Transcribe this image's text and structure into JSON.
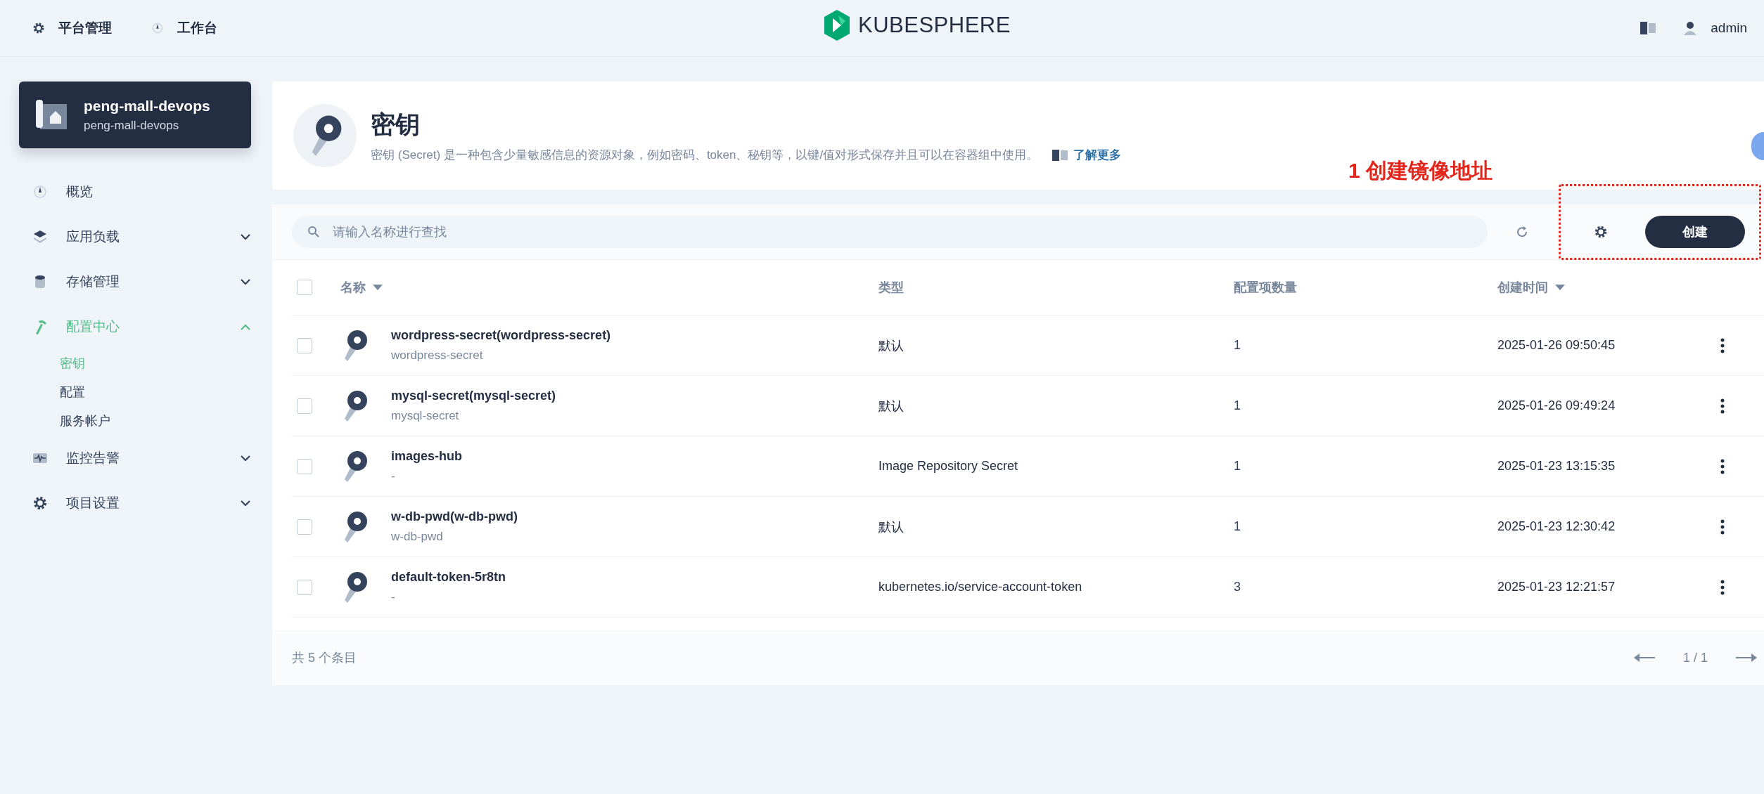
{
  "top_bar": {
    "nav": [
      {
        "label": "平台管理"
      },
      {
        "label": "工作台"
      }
    ],
    "logo_text": "KUBESPHERE",
    "user": "admin"
  },
  "project": {
    "title": "peng-mall-devops",
    "subtitle": "peng-mall-devops"
  },
  "sidebar": {
    "items": [
      {
        "label": "概览",
        "kind": "link",
        "selected": false
      },
      {
        "label": "应用负载",
        "kind": "group",
        "expanded": false,
        "selected": false
      },
      {
        "label": "存储管理",
        "kind": "group",
        "expanded": false,
        "selected": false
      },
      {
        "label": "配置中心",
        "kind": "group",
        "expanded": true,
        "selected": true,
        "children": [
          {
            "label": "密钥",
            "selected": true
          },
          {
            "label": "配置",
            "selected": false
          },
          {
            "label": "服务帐户",
            "selected": false
          }
        ]
      },
      {
        "label": "监控告警",
        "kind": "group",
        "expanded": false,
        "selected": false
      },
      {
        "label": "项目设置",
        "kind": "group",
        "expanded": false,
        "selected": false
      }
    ]
  },
  "header": {
    "title": "密钥",
    "description": "密钥 (Secret) 是一种包含少量敏感信息的资源对象，例如密码、token、秘钥等，以键/值对形式保存并且可以在容器组中使用。",
    "link": "了解更多"
  },
  "annotation": {
    "text": "1 创建镜像地址"
  },
  "toolbar": {
    "search": {
      "placeholder": "请输入名称进行查找"
    },
    "create_button": "创建"
  },
  "table": {
    "select_all_checked": false,
    "columns": [
      {
        "label": "名称",
        "sortable": true
      },
      {
        "label": "类型",
        "sortable": false
      },
      {
        "label": "配置项数量",
        "sortable": false
      },
      {
        "label": "创建时间",
        "sortable": true
      }
    ],
    "rows": [
      {
        "checked": false,
        "name": "wordpress-secret(wordpress-secret)",
        "alias": "wordpress-secret",
        "type": "默认",
        "count": "1",
        "created": "2025-01-26 09:50:45"
      },
      {
        "checked": false,
        "name": "mysql-secret(mysql-secret)",
        "alias": "mysql-secret",
        "type": "默认",
        "count": "1",
        "created": "2025-01-26 09:49:24"
      },
      {
        "checked": false,
        "name": "images-hub",
        "alias": "-",
        "type": "Image Repository Secret",
        "count": "1",
        "created": "2025-01-23 13:15:35"
      },
      {
        "checked": false,
        "name": "w-db-pwd(w-db-pwd)",
        "alias": "w-db-pwd",
        "type": "默认",
        "count": "1",
        "created": "2025-01-23 12:30:42"
      },
      {
        "checked": false,
        "name": "default-token-5r8tn",
        "alias": "-",
        "type": "kubernetes.io/service-account-token",
        "count": "3",
        "created": "2025-01-23 12:21:57"
      }
    ]
  },
  "footer": {
    "total": "共 5 个条目",
    "page": "1 / 1"
  }
}
